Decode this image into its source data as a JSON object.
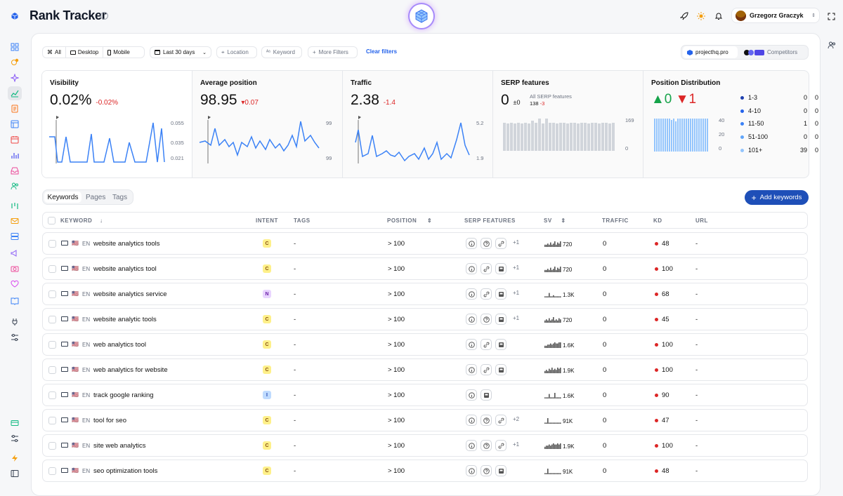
{
  "app": {
    "title": "Rank Tracker",
    "user": "Grzegorz Graczyk"
  },
  "filters": {
    "all": "All",
    "desktop": "Desktop",
    "mobile": "Mobile",
    "date": "Last 30 days",
    "location": "Location",
    "keyword": "Keyword",
    "more": "More Filters",
    "clear": "Clear filters",
    "project": "projecthq.pro",
    "competitors": "Competitors"
  },
  "cards": {
    "visibility": {
      "title": "Visibility",
      "value": "0.02%",
      "delta": "-0.02%",
      "ticks": [
        "0.055",
        "0.035",
        "0.021"
      ]
    },
    "avg": {
      "title": "Average position",
      "value": "98.95",
      "delta": "▾0.07",
      "ticks": [
        "99",
        "99"
      ]
    },
    "traffic": {
      "title": "Traffic",
      "value": "2.38",
      "delta": "-1.4",
      "ticks": [
        "5.2",
        "1.9"
      ]
    },
    "serp": {
      "title": "SERP features",
      "value": "0",
      "delta": "±0",
      "sub": "All SERP features",
      "sub_value": "138",
      "sub_delta": "-3",
      "ticks": [
        "169",
        "0"
      ]
    },
    "dist": {
      "title": "Position Distribution",
      "up": "▲0",
      "down": "▼1",
      "ticks": [
        "40",
        "20",
        "0"
      ],
      "legend": [
        {
          "label": "1-3",
          "a": "0",
          "b": "0",
          "color": "#1e40af"
        },
        {
          "label": "4-10",
          "a": "0",
          "b": "0",
          "color": "#2563eb"
        },
        {
          "label": "11-50",
          "a": "1",
          "b": "0",
          "color": "#3b82f6"
        },
        {
          "label": "51-100",
          "a": "0",
          "b": "0",
          "color": "#60a5fa"
        },
        {
          "label": "101+",
          "a": "39",
          "b": "0",
          "color": "#93c5fd"
        }
      ]
    }
  },
  "tabs": {
    "keywords": "Keywords",
    "pages": "Pages",
    "tags": "Tags",
    "add": "Add keywords"
  },
  "table": {
    "headers": {
      "keyword": "KEYWORD",
      "intent": "INTENT",
      "tags": "TAGS",
      "position": "POSITION",
      "serp": "SERP FEATURES",
      "sv": "SV",
      "traffic": "TRAFFIC",
      "kd": "KD",
      "url": "URL"
    },
    "rows": [
      {
        "lang": "EN",
        "keyword": "website analytics tools",
        "intent": "C",
        "tags": "-",
        "position": "> 100",
        "serp": [
          "info",
          "help",
          "link"
        ],
        "more": "+1",
        "sv": "720",
        "traffic": "0",
        "kd": "48",
        "url": "-"
      },
      {
        "lang": "EN",
        "keyword": "website analytics tool",
        "intent": "C",
        "tags": "-",
        "position": "> 100",
        "serp": [
          "info",
          "link",
          "img"
        ],
        "more": "+1",
        "sv": "720",
        "traffic": "0",
        "kd": "100",
        "url": "-"
      },
      {
        "lang": "EN",
        "keyword": "website analytics service",
        "intent": "N",
        "tags": "-",
        "position": "> 100",
        "serp": [
          "info",
          "link",
          "img"
        ],
        "more": "+1",
        "sv": "1.3K",
        "traffic": "0",
        "kd": "68",
        "url": "-"
      },
      {
        "lang": "EN",
        "keyword": "website analytic tools",
        "intent": "C",
        "tags": "-",
        "position": "> 100",
        "serp": [
          "info",
          "help",
          "img"
        ],
        "more": "+1",
        "sv": "720",
        "traffic": "0",
        "kd": "45",
        "url": "-"
      },
      {
        "lang": "EN",
        "keyword": "web analytics tool",
        "intent": "C",
        "tags": "-",
        "position": "> 100",
        "serp": [
          "info",
          "link",
          "img"
        ],
        "more": "",
        "sv": "1.6K",
        "traffic": "0",
        "kd": "100",
        "url": "-"
      },
      {
        "lang": "EN",
        "keyword": "web analytics for website",
        "intent": "C",
        "tags": "-",
        "position": "> 100",
        "serp": [
          "info",
          "link",
          "img"
        ],
        "more": "",
        "sv": "1.9K",
        "traffic": "0",
        "kd": "100",
        "url": "-"
      },
      {
        "lang": "EN",
        "keyword": "track google ranking",
        "intent": "I",
        "tags": "-",
        "position": "> 100",
        "serp": [
          "info",
          "img"
        ],
        "more": "",
        "sv": "1.6K",
        "traffic": "0",
        "kd": "90",
        "url": "-"
      },
      {
        "lang": "EN",
        "keyword": "tool for seo",
        "intent": "C",
        "tags": "-",
        "position": "> 100",
        "serp": [
          "info",
          "help",
          "link"
        ],
        "more": "+2",
        "sv": "91K",
        "traffic": "0",
        "kd": "47",
        "url": "-"
      },
      {
        "lang": "EN",
        "keyword": "site web analytics",
        "intent": "C",
        "tags": "-",
        "position": "> 100",
        "serp": [
          "info",
          "help",
          "link"
        ],
        "more": "+1",
        "sv": "1.9K",
        "traffic": "0",
        "kd": "100",
        "url": "-"
      },
      {
        "lang": "EN",
        "keyword": "seo optimization tools",
        "intent": "C",
        "tags": "-",
        "position": "> 100",
        "serp": [
          "info",
          "help",
          "img"
        ],
        "more": "",
        "sv": "91K",
        "traffic": "0",
        "kd": "48",
        "url": "-"
      }
    ]
  }
}
